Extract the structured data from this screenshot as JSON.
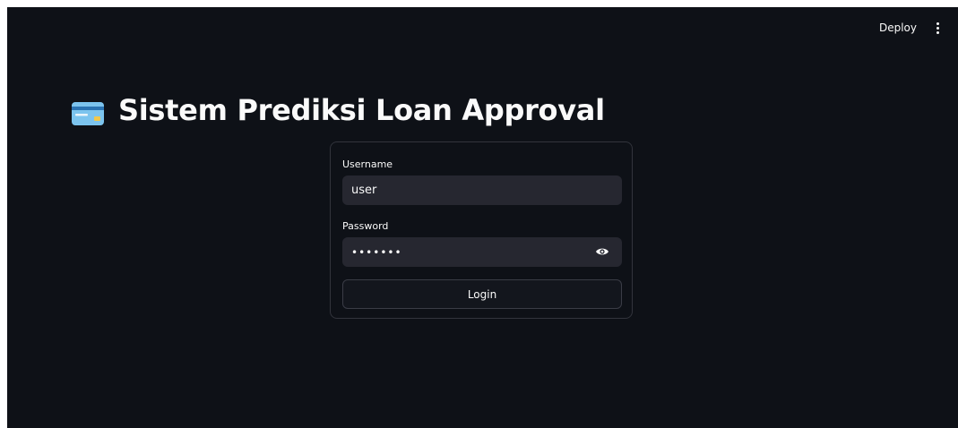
{
  "header": {
    "deploy_label": "Deploy",
    "menu_icon": "vertical-dots-icon"
  },
  "page": {
    "title_icon": "credit-card-icon",
    "title": "Sistem Prediksi Loan Approval"
  },
  "login_form": {
    "username_label": "Username",
    "username_value": "user",
    "password_label": "Password",
    "password_value": "•••••••",
    "password_toggle_icon": "eye-icon",
    "login_label": "Login"
  },
  "colors": {
    "background": "#0e1117",
    "input_background": "#262730",
    "text": "#fafafa",
    "border": "#32343c"
  }
}
